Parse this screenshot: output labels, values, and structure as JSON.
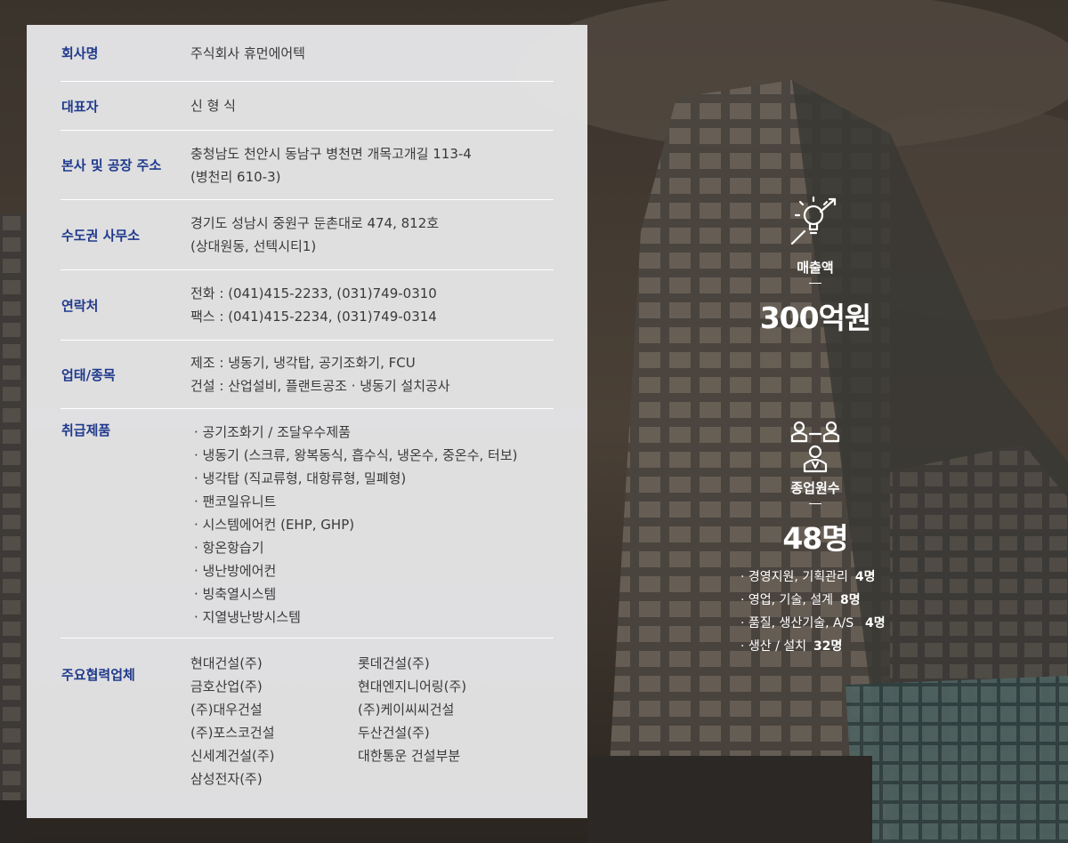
{
  "company": {
    "rows": [
      {
        "label": "회사명",
        "lines": [
          "주식회사 휴먼에어텍"
        ]
      },
      {
        "label": "대표자",
        "lines": [
          "신 형 식"
        ]
      },
      {
        "label": "본사 및 공장 주소",
        "lines": [
          "충청남도 천안시 동남구 병천면 개목고개길 113-4",
          "(병천리 610-3)"
        ]
      },
      {
        "label": "수도권 사무소",
        "lines": [
          "경기도 성남시 중원구 둔촌대로 474, 812호",
          "(상대원동, 선텍시티1)"
        ]
      },
      {
        "label": "연락처",
        "lines": [
          "전화 : (041)415-2233, (031)749-0310",
          "팩스 : (041)415-2234, (031)749-0314"
        ]
      },
      {
        "label": "업태/종목",
        "lines": [
          "제조 : 냉동기, 냉각탑, 공기조화기, FCU",
          "건설 : 산업설비, 플랜트공조 · 냉동기 설치공사"
        ]
      }
    ],
    "products": {
      "label": "취급제품",
      "items": [
        "· 공기조화기 / 조달우수제품",
        "· 냉동기 (스크류, 왕복동식, 흡수식, 냉온수, 중온수, 터보)",
        "· 냉각탑 (직교류형, 대항류형, 밀폐형)",
        "· 팬코일유니트",
        "· 시스템에어컨 (EHP, GHP)",
        "· 항온항습기",
        "· 냉난방에어컨",
        "· 빙축열시스템",
        "· 지열냉난방시스템"
      ]
    },
    "partners": {
      "label": "주요협력업체",
      "items": [
        "현대건설(주)",
        "롯데건설(주)",
        "금호산업(주)",
        "현대엔지니어링(주)",
        "(주)대우건설",
        "(주)케이씨씨건설",
        "(주)포스코건설",
        "두산건설(주)",
        "신세계건설(주)",
        "대한통운 건설부분",
        "삼성전자(주)"
      ]
    }
  },
  "stats": {
    "sales": {
      "title": "매출액",
      "value": "300억원",
      "icon": "lightbulb-icon"
    },
    "employees": {
      "title": "종업원수",
      "value": "48명",
      "icon": "team-icon",
      "breakdown": [
        {
          "text": "· 경영지원, 기획관리",
          "count": "4명"
        },
        {
          "text": "· 영업, 기술, 설계",
          "count": "8명"
        },
        {
          "text": "· 품질, 생산기술, A/S",
          "count": " 4명"
        },
        {
          "text": "· 생산 / 설치",
          "count": "32명"
        }
      ]
    }
  }
}
